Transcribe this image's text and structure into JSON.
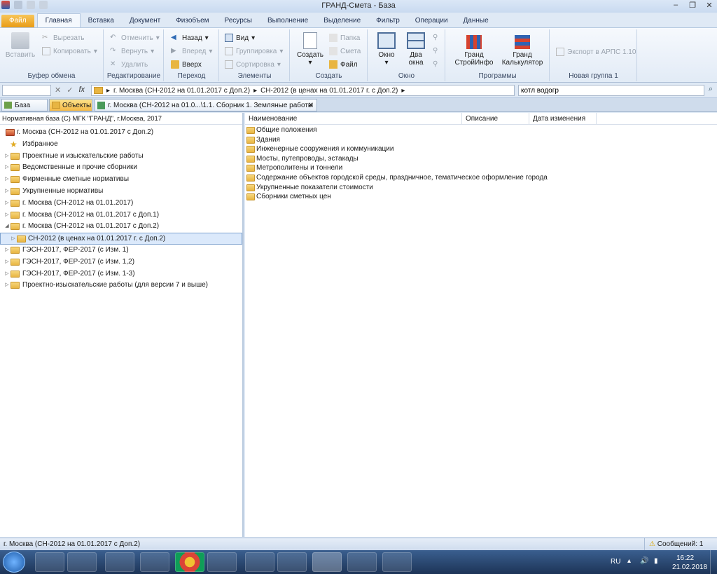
{
  "window": {
    "title": "ГРАНД-Смета - База"
  },
  "ribbon_tabs": [
    "Файл",
    "Главная",
    "Вставка",
    "Документ",
    "Физобъем",
    "Ресурсы",
    "Выполнение",
    "Выделение",
    "Фильтр",
    "Операции",
    "Данные"
  ],
  "ribbon": {
    "clipboard": {
      "label": "Буфер обмена",
      "paste": "Вставить",
      "cut": "Вырезать",
      "copy": "Копировать"
    },
    "edit": {
      "label": "Редактирование",
      "undo": "Отменить",
      "redo": "Вернуть",
      "delete": "Удалить"
    },
    "nav": {
      "label": "Переход",
      "back": "Назад",
      "forward": "Вперед",
      "up": "Вверх"
    },
    "elements": {
      "label": "Элементы",
      "view": "Вид",
      "grouping": "Группировка",
      "sorting": "Сортировка"
    },
    "create": {
      "label": "Создать",
      "create": "Создать",
      "folder": "Папка",
      "estimate": "Смета",
      "file": "Файл"
    },
    "window": {
      "label": "Окно",
      "window": "Окно",
      "two": "Два",
      "windows": "окна"
    },
    "programs": {
      "label": "Программы",
      "p1a": "Гранд",
      "p1b": "СтройИнфо",
      "p2a": "Гранд",
      "p2b": "Калькулятор"
    },
    "newgroup": {
      "label": "Новая группа 1",
      "export": "Экспорт в АРПС 1.10"
    }
  },
  "formula": {
    "path1": "г. Москва (СН-2012 на 01.01.2017 с Доп.2)",
    "path2": "СН-2012 (в ценах на 01.01.2017 г. с Доп.2)",
    "search": "котл водогр"
  },
  "doctabs": {
    "base": "База",
    "objects": "Объекты",
    "doc": "г. Москва (СН-2012 на 01.0...\\1.1. Сборник 1. Земляные работы"
  },
  "left": {
    "header": "Нормативная база (С) МГК \"ГРАНД\", г.Москва, 2017",
    "root": "г. Москва (СН-2012 на 01.01.2017 с Доп.2)",
    "favorites": "Избранное",
    "items": [
      "Проектные и изыскательские работы",
      "Ведомственные и прочие сборники",
      "Фирменные сметные нормативы",
      "Укрупненные нормативы",
      "г. Москва (СН-2012 на 01.01.2017)",
      "г. Москва (СН-2012 на 01.01.2017 с Доп.1)",
      "г. Москва (СН-2012 на 01.01.2017 с Доп.2)",
      "СН-2012 (в ценах на 01.01.2017 г. с Доп.2)",
      "ГЭСН-2017, ФЕР-2017 (с Изм. 1)",
      "ГЭСН-2017, ФЕР-2017 (с Изм. 1,2)",
      "ГЭСН-2017, ФЕР-2017 (с Изм. 1-3)",
      "Проектно-изыскательские работы (для версии 7 и выше)"
    ]
  },
  "right": {
    "columns": [
      "Наименование",
      "Описание",
      "Дата изменения"
    ],
    "rows": [
      "Общие положения",
      "Здания",
      "Инженерные сооружения и коммуникации",
      "Мосты, путепроводы, эстакады",
      "Метрополитены и тоннели",
      "Содержание объектов городской среды, праздничное, тематическое оформление города",
      "Укрупненные показатели стоимости",
      "Сборники сметных цен"
    ]
  },
  "status": {
    "left": "г. Москва (СН-2012 на 01.01.2017 с Доп.2)",
    "messages": "Сообщений: 1"
  },
  "tray": {
    "lang": "RU",
    "time": "16:22",
    "date": "21.02.2018"
  }
}
